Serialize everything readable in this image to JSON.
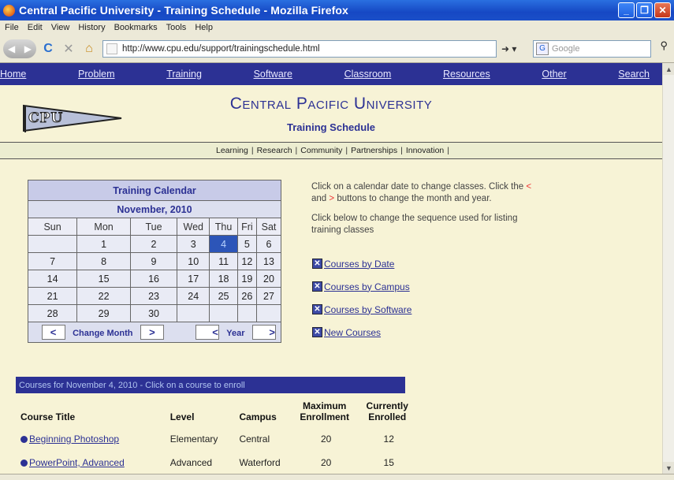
{
  "window": {
    "title": "Central Pacific University - Training Schedule - Mozilla Firefox"
  },
  "menu": [
    "File",
    "Edit",
    "View",
    "History",
    "Bookmarks",
    "Tools",
    "Help"
  ],
  "address": {
    "url": "http://www.cpu.edu/support/trainingschedule.html",
    "search_placeholder": "Google"
  },
  "site_nav": [
    "Home",
    "Problem",
    "Training",
    "Software",
    "Classroom",
    "Resources",
    "Other",
    "Search"
  ],
  "header": {
    "logo_text": "CPU",
    "title": "Central Pacific University",
    "subtitle": "Training Schedule"
  },
  "sub_nav": [
    "Learning",
    "Research",
    "Community",
    "Partnerships",
    "Innovation"
  ],
  "calendar": {
    "title": "Training Calendar",
    "month": "November, 2010",
    "days_of_week": [
      "Sun",
      "Mon",
      "Tue",
      "Wed",
      "Thu",
      "Fri",
      "Sat"
    ],
    "weeks": [
      [
        "",
        "1",
        "2",
        "3",
        "4",
        "5",
        "6"
      ],
      [
        "7",
        "8",
        "9",
        "10",
        "11",
        "12",
        "13"
      ],
      [
        "14",
        "15",
        "16",
        "17",
        "18",
        "19",
        "20"
      ],
      [
        "21",
        "22",
        "23",
        "24",
        "25",
        "26",
        "27"
      ],
      [
        "28",
        "29",
        "30",
        "",
        "",
        "",
        ""
      ]
    ],
    "selected_day": "4",
    "prev": "<",
    "next": ">",
    "change_month_label": "Change Month",
    "year_label": "Year"
  },
  "info": {
    "line1": "Click on a calendar date to change classes. Click the",
    "lt": "<",
    "and": "and",
    "gt": ">",
    "line1_end": "buttons to change the month and year.",
    "line2": "Click below to change the sequence used for listing training classes"
  },
  "sort_links": [
    "Courses by Date",
    "Courses by Campus",
    "Courses by Software",
    "New Courses"
  ],
  "courses": {
    "banner": "Courses for November 4, 2010 - Click on a course to enroll",
    "headers": {
      "title": "Course Title",
      "level": "Level",
      "campus": "Campus",
      "max1": "Maximum",
      "max2": "Enrollment",
      "cur1": "Currently",
      "cur2": "Enrolled"
    },
    "rows": [
      {
        "title": "Beginning Photoshop",
        "level": "Elementary",
        "campus": "Central",
        "max": "20",
        "enrolled": "12"
      },
      {
        "title": "PowerPoint, Advanced",
        "level": "Advanced",
        "campus": "Waterford",
        "max": "20",
        "enrolled": "15"
      }
    ]
  }
}
